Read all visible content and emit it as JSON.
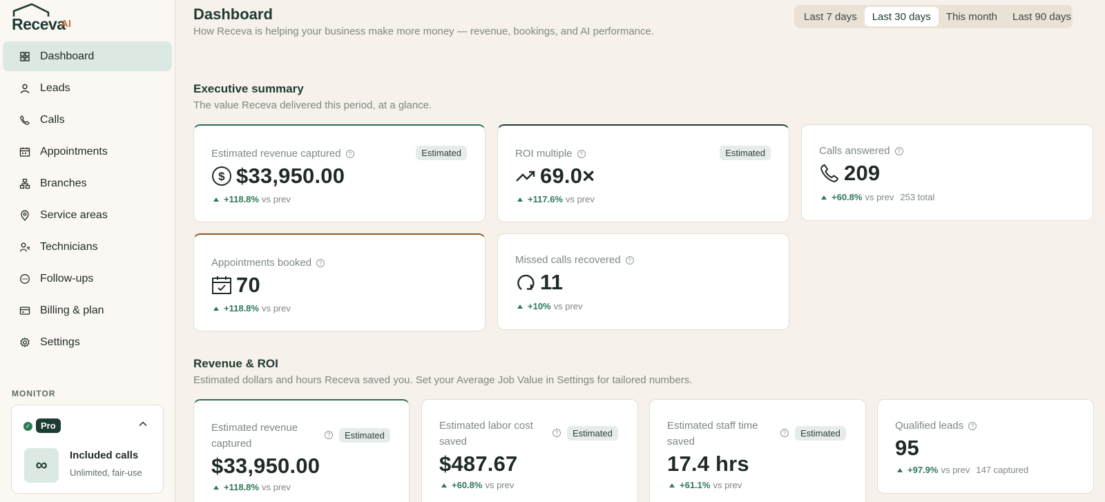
{
  "brand": {
    "name": "Receva",
    "suffix": "AI"
  },
  "sidebar": {
    "items": [
      {
        "label": "Dashboard",
        "icon": "grid-icon",
        "active": true
      },
      {
        "label": "Leads",
        "icon": "user-icon"
      },
      {
        "label": "Calls",
        "icon": "phone-icon"
      },
      {
        "label": "Appointments",
        "icon": "calendar-icon"
      },
      {
        "label": "Branches",
        "icon": "branches-icon"
      },
      {
        "label": "Service areas",
        "icon": "map-pin-icon"
      },
      {
        "label": "Technicians",
        "icon": "technician-icon"
      },
      {
        "label": "Follow-ups",
        "icon": "chat-bubble-icon"
      },
      {
        "label": "Billing & plan",
        "icon": "credit-card-icon"
      },
      {
        "label": "Settings",
        "icon": "gear-icon"
      }
    ],
    "monitor_label": "MONITOR",
    "plan": {
      "badge": "Pro",
      "title": "Included calls",
      "subtitle": "Unlimited, fair-use",
      "symbol": "∞"
    }
  },
  "header": {
    "title": "Dashboard",
    "subtitle": "How Receva is helping your business make more money — revenue, bookings, and AI performance.",
    "ranges": [
      "Last 7 days",
      "Last 30 days",
      "This month",
      "Last 90 days"
    ],
    "selected_range": "Last 30 days"
  },
  "executive": {
    "title": "Executive summary",
    "subtitle": "The value Receva delivered this period, at a glance.",
    "cards": [
      {
        "label": "Estimated revenue captured",
        "badge": "Estimated",
        "value": "$33,950.00",
        "delta": "+118.8%",
        "vs": "vs prev",
        "icon": "dollar-icon"
      },
      {
        "label": "ROI multiple",
        "badge": "Estimated",
        "value": "69.0×",
        "delta": "+117.6%",
        "vs": "vs prev",
        "icon": "trend-up-icon"
      },
      {
        "label": "Calls answered",
        "value": "209",
        "delta": "+60.8%",
        "vs": "vs prev",
        "extra": "253 total",
        "icon": "phone-icon"
      },
      {
        "label": "Appointments booked",
        "value": "70",
        "delta": "+118.8%",
        "vs": "vs prev",
        "icon": "calendar-check-icon"
      },
      {
        "label": "Missed calls recovered",
        "value": "11",
        "delta": "+10%",
        "vs": "vs prev",
        "icon": "refresh-icon"
      }
    ]
  },
  "revenue": {
    "title": "Revenue & ROI",
    "subtitle": "Estimated dollars and hours Receva saved you. Set your Average Job Value in Settings for tailored numbers.",
    "cards": [
      {
        "label_line1": "Estimated revenue",
        "label_line2": "captured",
        "badge": "Estimated",
        "value": "$33,950.00",
        "delta": "+118.8%",
        "vs": "vs prev"
      },
      {
        "label_line1": "Estimated labor cost",
        "label_line2": "saved",
        "badge": "Estimated",
        "value": "$487.67",
        "delta": "+60.8%",
        "vs": "vs prev"
      },
      {
        "label_line1": "Estimated staff time",
        "label_line2": "saved",
        "badge": "Estimated",
        "value": "17.4 hrs",
        "delta": "+61.1%",
        "vs": "vs prev"
      },
      {
        "label": "Qualified leads",
        "value": "95",
        "delta": "+97.9%",
        "vs": "vs prev",
        "extra": "147 captured"
      }
    ]
  },
  "help_symbol": "?",
  "colors": {
    "accent": "#2b6b52",
    "active_nav": "#dce8e2",
    "background": "#f6f1ea",
    "positive": "#2d7a56"
  }
}
